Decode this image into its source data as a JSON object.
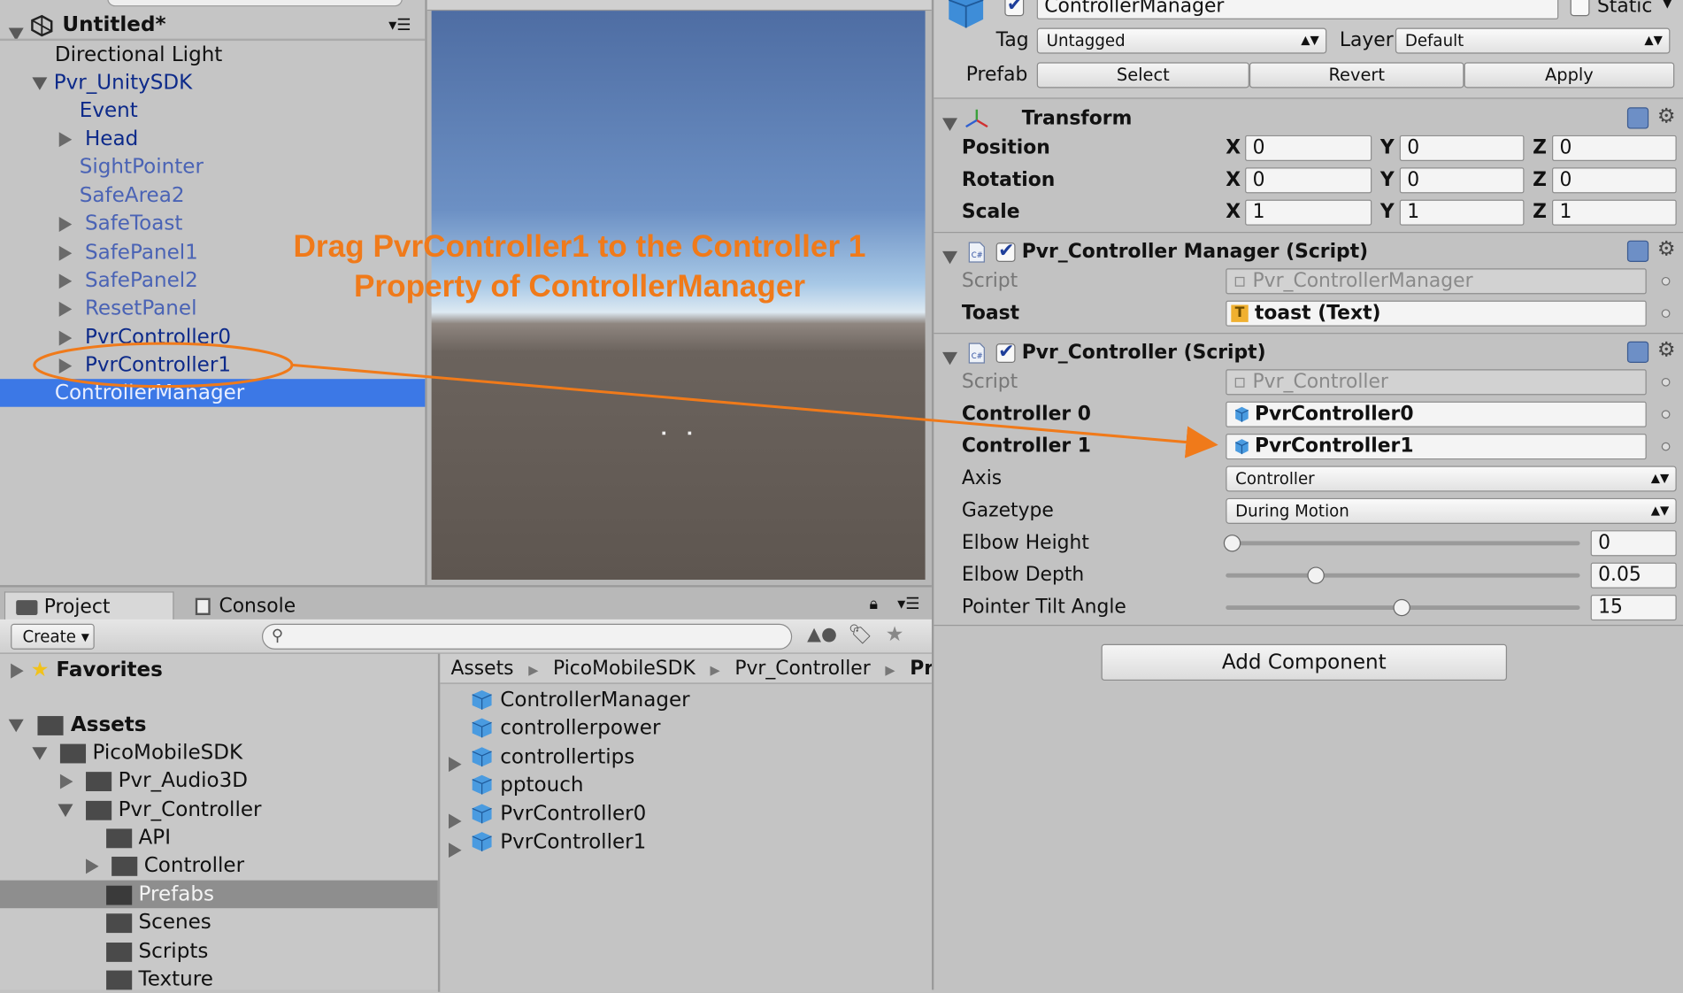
{
  "hierarchy": {
    "scene_name": "Untitled*",
    "items": [
      "Directional Light",
      "Pvr_UnitySDK",
      "Event",
      "Head",
      "SightPointer",
      "SafeArea2",
      "SafeToast",
      "SafePanel1",
      "SafePanel2",
      "ResetPanel",
      "PvrController0",
      "PvrController1",
      "ControllerManager"
    ]
  },
  "annotation": {
    "line1": "Drag PvrController1 to the Controller 1",
    "line2": "Property of ControllerManager",
    "color": "#f07a1a"
  },
  "project": {
    "tabs": [
      "Project",
      "Console"
    ],
    "create_label": "Create",
    "favorites_label": "Favorites",
    "tree": [
      "Assets",
      "PicoMobileSDK",
      "Pvr_Audio3D",
      "Pvr_Controller",
      "API",
      "Controller",
      "Prefabs",
      "Scenes",
      "Scripts",
      "Texture"
    ],
    "breadcrumb": [
      "Assets",
      "PicoMobileSDK",
      "Pvr_Controller",
      "Pref"
    ],
    "assets": [
      "ControllerManager",
      "controllerpower",
      "controllertips",
      "pptouch",
      "PvrController0",
      "PvrController1"
    ]
  },
  "inspector": {
    "object_name": "ControllerManager",
    "static_label": "Static",
    "tag_label": "Tag",
    "tag_value": "Untagged",
    "layer_label": "Layer",
    "layer_value": "Default",
    "prefab_label": "Prefab",
    "prefab_buttons": [
      "Select",
      "Revert",
      "Apply"
    ],
    "transform": {
      "title": "Transform",
      "rows": [
        {
          "label": "Position",
          "x": "0",
          "y": "0",
          "z": "0"
        },
        {
          "label": "Rotation",
          "x": "0",
          "y": "0",
          "z": "0"
        },
        {
          "label": "Scale",
          "x": "1",
          "y": "1",
          "z": "1"
        }
      ],
      "axis_x": "X",
      "axis_y": "Y",
      "axis_z": "Z"
    },
    "manager_script": {
      "title": "Pvr_Controller Manager (Script)",
      "script_label": "Script",
      "script_value": "Pvr_ControllerManager",
      "toast_label": "Toast",
      "toast_value": "toast (Text)"
    },
    "controller_script": {
      "title": "Pvr_Controller (Script)",
      "script_label": "Script",
      "script_value": "Pvr_Controller",
      "c0_label": "Controller 0",
      "c0_value": "PvrController0",
      "c1_label": "Controller 1",
      "c1_value": "PvrController1",
      "axis_label": "Axis",
      "axis_value": "Controller",
      "gaze_label": "Gazetype",
      "gaze_value": "During Motion",
      "elbow_h_label": "Elbow Height",
      "elbow_h_value": "0",
      "elbow_d_label": "Elbow Depth",
      "elbow_d_value": "0.05",
      "tilt_label": "Pointer Tilt Angle",
      "tilt_value": "15"
    },
    "add_component": "Add Component"
  }
}
